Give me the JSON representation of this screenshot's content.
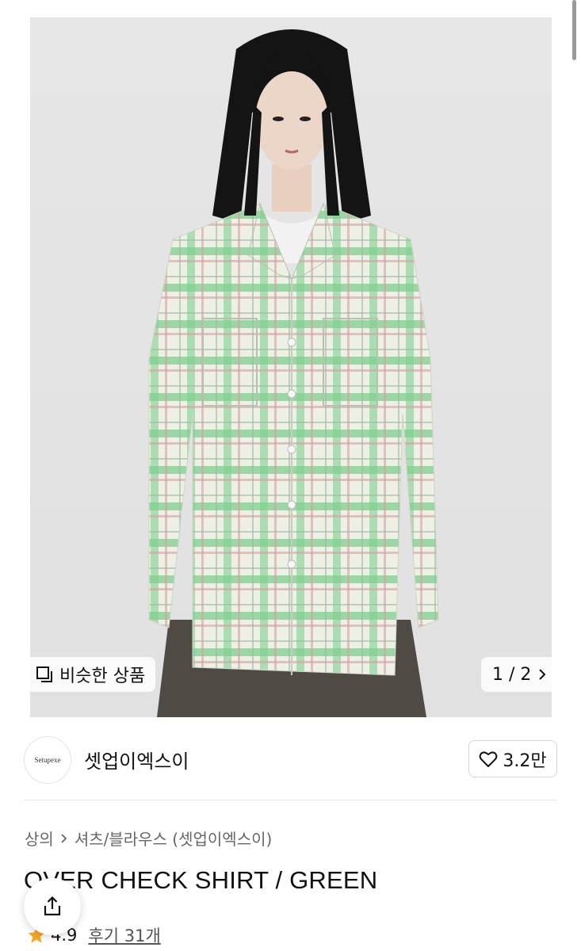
{
  "gallery": {
    "similar_label": "비슷한 상품",
    "counter": "1 / 2"
  },
  "brand": {
    "logo_text": "Setupexe",
    "name": "셋업이엑스이",
    "likes": "3.2만"
  },
  "breadcrumb": {
    "category": "상의",
    "subcategory": "셔츠/블라우스 (셋업이엑스이)"
  },
  "product": {
    "title": "OVER CHECK SHIRT / GREEN",
    "rating": "4.9",
    "reviews": "후기 31개"
  },
  "colors": {
    "star": "#f5a623",
    "plaid_green": "#5fc07a"
  },
  "icons": [
    "similar-products-icon",
    "chevron-right-icon",
    "heart-icon",
    "star-icon",
    "share-icon"
  ]
}
